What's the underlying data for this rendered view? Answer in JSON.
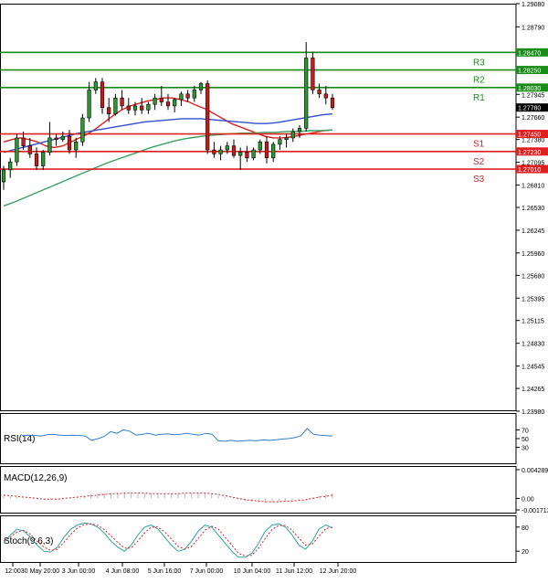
{
  "chart_data": {
    "type": "candlestick",
    "main": {
      "price_ticks": [
        "1.29080",
        "1.28790",
        "1.28470",
        "1.28250",
        "1.28030",
        "1.27945",
        "1.27780",
        "1.27660",
        "1.27450",
        "1.27380",
        "1.27230",
        "1.27095",
        "1.27010",
        "1.26810",
        "1.26530",
        "1.26245",
        "1.25960",
        "1.25680",
        "1.25395",
        "1.25115",
        "1.24830",
        "1.24545",
        "1.24265",
        "1.23980"
      ],
      "ylim": [
        1.2398,
        1.2908
      ],
      "current_price": "1.27780",
      "candles": [
        [
          1.2685,
          1.2705,
          1.2675,
          1.27
        ],
        [
          1.27,
          1.2715,
          1.269,
          1.271
        ],
        [
          1.271,
          1.2745,
          1.2705,
          1.274
        ],
        [
          1.274,
          1.2748,
          1.2725,
          1.273
        ],
        [
          1.273,
          1.274,
          1.2715,
          1.272
        ],
        [
          1.272,
          1.2728,
          1.27,
          1.2705
        ],
        [
          1.2705,
          1.2725,
          1.27,
          1.2722
        ],
        [
          1.2722,
          1.276,
          1.2718,
          1.274
        ],
        [
          1.274,
          1.2745,
          1.273,
          1.2738
        ],
        [
          1.2738,
          1.2748,
          1.2735,
          1.2742
        ],
        [
          1.2742,
          1.275,
          1.272,
          1.2725
        ],
        [
          1.2725,
          1.274,
          1.2715,
          1.2735
        ],
        [
          1.2735,
          1.277,
          1.273,
          1.2765
        ],
        [
          1.2765,
          1.281,
          1.276,
          1.28
        ],
        [
          1.28,
          1.2815,
          1.2795,
          1.281
        ],
        [
          1.281,
          1.2815,
          1.277,
          1.2778
        ],
        [
          1.2778,
          1.279,
          1.276,
          1.277
        ],
        [
          1.277,
          1.2795,
          1.2768,
          1.279
        ],
        [
          1.279,
          1.28,
          1.2775,
          1.278
        ],
        [
          1.278,
          1.279,
          1.277,
          1.2775
        ],
        [
          1.2775,
          1.2785,
          1.2768,
          1.278
        ],
        [
          1.278,
          1.279,
          1.277,
          1.2775
        ],
        [
          1.2775,
          1.2785,
          1.277,
          1.2782
        ],
        [
          1.2782,
          1.2795,
          1.2775,
          1.279
        ],
        [
          1.279,
          1.2805,
          1.278,
          1.2785
        ],
        [
          1.2785,
          1.2795,
          1.2775,
          1.278
        ],
        [
          1.278,
          1.279,
          1.2772,
          1.2788
        ],
        [
          1.2788,
          1.2798,
          1.278,
          1.2795
        ],
        [
          1.2795,
          1.28,
          1.2785,
          1.279
        ],
        [
          1.279,
          1.2805,
          1.2785,
          1.28
        ],
        [
          1.28,
          1.281,
          1.2795,
          1.2808
        ],
        [
          1.2808,
          1.2812,
          1.272,
          1.2725
        ],
        [
          1.2725,
          1.2735,
          1.2715,
          1.272
        ],
        [
          1.272,
          1.273,
          1.2712,
          1.2725
        ],
        [
          1.2725,
          1.2735,
          1.272,
          1.273
        ],
        [
          1.273,
          1.2738,
          1.2715,
          1.2718
        ],
        [
          1.2718,
          1.2728,
          1.27,
          1.2722
        ],
        [
          1.2722,
          1.273,
          1.271,
          1.2715
        ],
        [
          1.2715,
          1.2728,
          1.2712,
          1.2725
        ],
        [
          1.2725,
          1.2738,
          1.272,
          1.2735
        ],
        [
          1.2735,
          1.2742,
          1.2708,
          1.2715
        ],
        [
          1.2715,
          1.2735,
          1.271,
          1.2732
        ],
        [
          1.2732,
          1.2742,
          1.2725,
          1.2738
        ],
        [
          1.2738,
          1.2745,
          1.2728,
          1.274
        ],
        [
          1.274,
          1.2752,
          1.2735,
          1.2748
        ],
        [
          1.2748,
          1.2756,
          1.274,
          1.2752
        ],
        [
          1.2752,
          1.286,
          1.2748,
          1.284
        ],
        [
          1.284,
          1.2848,
          1.2795,
          1.28
        ],
        [
          1.28,
          1.2808,
          1.279,
          1.2795
        ],
        [
          1.2795,
          1.2805,
          1.2782,
          1.279
        ],
        [
          1.279,
          1.2795,
          1.2775,
          1.2778
        ]
      ],
      "levels": [
        {
          "label": "R3",
          "price_label": "1.28470",
          "price": 1.2847,
          "color": "#1a8c1a"
        },
        {
          "label": "R2",
          "price_label": "1.28250",
          "price": 1.2825,
          "color": "#1a8c1a"
        },
        {
          "label": "R1",
          "price_label": "1.28030",
          "price": 1.2803,
          "color": "#1a8c1a"
        },
        {
          "label": "S1",
          "price_label": "1.27450",
          "price": 1.2745,
          "color": "#e02020"
        },
        {
          "label": "S2",
          "price_label": "1.27230",
          "price": 1.2723,
          "color": "#e02020"
        },
        {
          "label": "S3",
          "price_label": "1.27010",
          "price": 1.2701,
          "color": "#e02020"
        }
      ],
      "moving_averages": [
        {
          "color": "#e02020",
          "values": [
            1.2735,
            1.2738,
            1.274,
            1.2738,
            1.2735,
            1.273,
            1.2728,
            1.273,
            1.2735,
            1.274,
            1.2745,
            1.2752,
            1.276,
            1.2768,
            1.2775,
            1.278,
            1.2783,
            1.2786,
            1.2788,
            1.279,
            1.279,
            1.2788,
            1.2785,
            1.278,
            1.2776,
            1.277,
            1.2764,
            1.2758,
            1.2754,
            1.275,
            1.2746,
            1.2742,
            1.274,
            1.274,
            1.2741,
            1.2743,
            1.2745,
            1.2747,
            1.2749,
            1.275
          ]
        },
        {
          "color": "#3050d0",
          "values": [
            1.2722,
            1.2725,
            1.2728,
            1.2731,
            1.2734,
            1.2737,
            1.274,
            1.2743,
            1.2746,
            1.2748,
            1.275,
            1.2752,
            1.2754,
            1.2756,
            1.2758,
            1.276,
            1.2761,
            1.2762,
            1.2763,
            1.2764,
            1.2764,
            1.2764,
            1.2763,
            1.2762,
            1.2761,
            1.276,
            1.2759,
            1.2758,
            1.2758,
            1.2759,
            1.2761,
            1.2763,
            1.2765,
            1.2767,
            1.2769,
            1.277
          ]
        },
        {
          "color": "#3aa060",
          "values": [
            1.2655,
            1.266,
            1.2666,
            1.2672,
            1.2678,
            1.2684,
            1.269,
            1.2696,
            1.2702,
            1.2708,
            1.2713,
            1.2718,
            1.2723,
            1.2728,
            1.2732,
            1.2736,
            1.2739,
            1.2741,
            1.2743,
            1.2744,
            1.2745,
            1.2746,
            1.2746,
            1.2747,
            1.2747,
            1.2748,
            1.2748,
            1.2749,
            1.2749,
            1.275
          ]
        }
      ]
    },
    "rsi": {
      "label": "RSI(14)",
      "ticks": [
        "70",
        "50",
        "30"
      ],
      "ylim": [
        0,
        100
      ],
      "values": [
        57,
        58,
        57,
        56,
        59,
        60,
        58,
        57,
        58,
        57,
        56,
        46,
        50,
        55,
        66,
        62,
        70,
        67,
        58,
        60,
        62,
        58,
        60,
        61,
        59,
        60,
        62,
        60,
        58,
        62,
        60,
        45,
        44,
        46,
        44,
        45,
        46,
        45,
        47,
        46,
        47,
        49,
        50,
        52,
        56,
        73,
        60,
        58,
        57,
        56
      ]
    },
    "macd": {
      "label": "MACD(12,26,9)",
      "ticks": [
        "0.004289",
        "0.00",
        "-0.001713"
      ],
      "ylim": [
        -0.001713,
        0.004289
      ],
      "histogram": [
        0.0004,
        0.0003,
        0.0002,
        0.0001,
        0.0,
        -0.0001,
        -0.0002,
        -0.0002,
        -0.0001,
        0.0,
        0.0001,
        0.0002,
        0.0004,
        0.0006,
        0.0007,
        0.0008,
        0.0008,
        0.0009,
        0.0009,
        0.0008,
        0.0008,
        0.0007,
        0.0007,
        0.0007,
        0.0007,
        0.0008,
        0.0008,
        0.0008,
        0.0008,
        0.0008,
        0.0008,
        0.0006,
        0.0004,
        0.0002,
        0.0,
        -0.0002,
        -0.0004,
        -0.0005,
        -0.0006,
        -0.0006,
        -0.0006,
        -0.0005,
        -0.0004,
        -0.0003,
        -0.0002,
        0.0,
        0.0002,
        0.0004,
        0.0006,
        0.0007
      ],
      "signal": [
        0.0005,
        0.0004,
        0.0003,
        0.0002,
        0.0001,
        0.0,
        -0.0001,
        -0.0001,
        -0.0001,
        0.0,
        0.0001,
        0.0002,
        0.0003,
        0.0004,
        0.0005,
        0.0006,
        0.0007,
        0.0007,
        0.0008,
        0.0008,
        0.0008,
        0.0008,
        0.0007,
        0.0007,
        0.0007,
        0.0007,
        0.0007,
        0.0008,
        0.0008,
        0.0008,
        0.0008,
        0.0007,
        0.0006,
        0.0004,
        0.0002,
        0.0,
        -0.0002,
        -0.0003,
        -0.0004,
        -0.0005,
        -0.0005,
        -0.0005,
        -0.0004,
        -0.0004,
        -0.0003,
        -0.0002,
        0.0,
        0.0002,
        0.0003,
        0.0005
      ]
    },
    "stoch": {
      "label": "Stoch(9,6,3)",
      "ticks": [
        "80",
        "20"
      ],
      "ylim": [
        0,
        100
      ],
      "main": [
        40,
        60,
        75,
        70,
        55,
        35,
        20,
        18,
        30,
        55,
        75,
        85,
        90,
        88,
        80,
        65,
        45,
        30,
        20,
        35,
        60,
        80,
        85,
        75,
        55,
        35,
        20,
        25,
        45,
        70,
        85,
        80,
        60,
        40,
        20,
        5,
        5,
        15,
        40,
        70,
        85,
        88,
        80,
        60,
        35,
        25,
        45,
        75,
        85,
        78
      ],
      "signal": [
        45,
        55,
        68,
        72,
        62,
        45,
        30,
        22,
        25,
        42,
        62,
        78,
        86,
        88,
        84,
        74,
        58,
        42,
        28,
        28,
        45,
        66,
        80,
        80,
        68,
        50,
        32,
        25,
        32,
        52,
        72,
        82,
        75,
        55,
        35,
        15,
        8,
        10,
        28,
        52,
        74,
        84,
        84,
        72,
        52,
        35,
        38,
        58,
        76,
        80
      ]
    },
    "x_ticks": [
      "12:00",
      "30 May 20:00",
      "3 Jun 00:00",
      "4 Jun 08:00",
      "5 Jun 16:00",
      "7 Jun 00:00",
      "10 Jun 04:00",
      "11 Jun 12:00",
      "12 Jun 20:00"
    ]
  }
}
